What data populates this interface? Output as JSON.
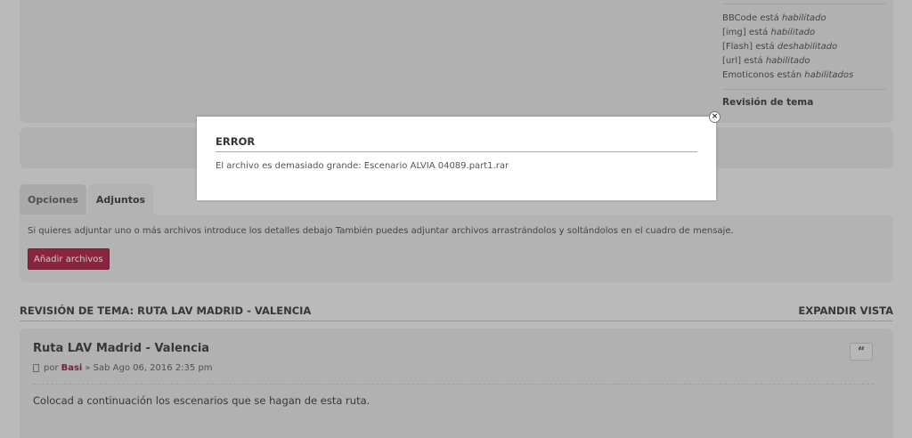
{
  "options": {
    "bbcode": {
      "prefix": "BBCode está",
      "state": "habilitado"
    },
    "img": {
      "prefix": "[img] está",
      "state": "habilitado"
    },
    "flash": {
      "prefix": "[Flash] está",
      "state": "deshabilitado"
    },
    "url": {
      "prefix": "[url] está",
      "state": "habilitado"
    },
    "emoticons": {
      "prefix": "Emoticonos están",
      "state": "habilitados"
    },
    "topic_review": "Revisión de tema"
  },
  "tabs": {
    "options": "Opciones",
    "attachments": "Adjuntos"
  },
  "attachments": {
    "help_text": "Si quieres adjuntar uno o más archivos introduce los detalles debajo También puedes adjuntar archivos arrastrándolos y soltándolos en el cuadro de mensaje.",
    "add_button": "Añadir archivos"
  },
  "review": {
    "heading": "REVISIÓN DE TEMA: RUTA LAV MADRID - VALENCIA",
    "expand": "EXPANDIR VISTA"
  },
  "post": {
    "title": "Ruta LAV Madrid - Valencia",
    "by": "por",
    "author": "Basi",
    "date": "» Sab Ago 06, 2016 2:35 pm",
    "body": "Colocad a continuación los escenarios que se hagan de esta ruta.",
    "quote_icon": "quote-icon",
    "quote_glyph": "“"
  },
  "modal": {
    "title": "ERROR",
    "message": "El archivo es demasiado grande: Escenario ALVIA 04089.part1.rar",
    "close_glyph": "×"
  },
  "colors": {
    "accent": "#a21a3c",
    "author": "#8b1233"
  }
}
